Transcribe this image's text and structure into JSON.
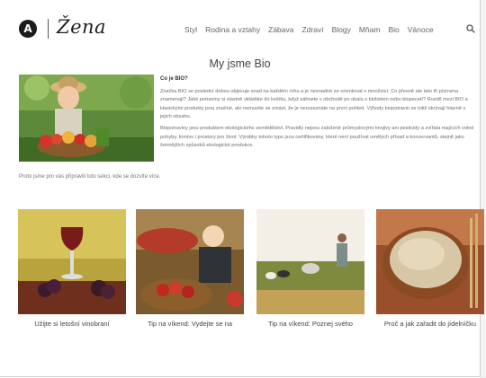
{
  "header": {
    "logo_letter": "A",
    "logo_text": "Žena",
    "nav": [
      "Styl",
      "Rodina a vztahy",
      "Zábava",
      "Zdraví",
      "Blogy",
      "Mňam",
      "Bio",
      "Vánoce"
    ]
  },
  "article": {
    "title": "My jsme Bio",
    "question": "Co je BIO?",
    "paragraph1": "Značka BIO se poslední dobou objevuje snad na každém rohu a je nesnadné se orientovat v množství. Co přesně ale tato tři písmena znamenají? Jaké potraviny si vlastně vkládáte do košíku, když sáhnete v obchodě po obalu s biolistem nebo biopecetí? Rozdíl mezi BIO a klasickými produkty jsou značné, ale nemusíte se zmást, že je nerozeznáte na první pohled. Výhody biopotravin se totiž skrývají hlavně v jejich obsahu.",
    "paragraph2": "Biopotraviny jsou produktem ekologického zemědělství. Pravidly nejsou založené průmyslovými hnojivy ani pesticidy a zvířata majících volné pohyby, krmivo i prostory pro život. Výrobky tohoto typu jsou certifikovány, které není používat umělých přísad a konzervantů, stejně jako šetrnějších způsobů ekologické produkce.",
    "lead": "Proto jsme pro vás připravili tuto sekci, kde se dozvíte více."
  },
  "cards": [
    {
      "caption": "Užijte si letošní vinobraní"
    },
    {
      "caption": "Tip na víkend: Vydejte se na"
    },
    {
      "caption": "Tip na víkend: Poznej svého"
    },
    {
      "caption": "Proč a jak zařadit do jídelníčku"
    }
  ]
}
